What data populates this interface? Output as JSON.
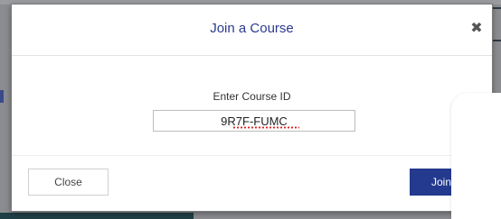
{
  "modal": {
    "title": "Join a Course",
    "close_icon": "close-icon",
    "field_label": "Enter Course ID",
    "course_id_value": "9R7F-FUMC",
    "course_id_placeholder": ""
  },
  "footer": {
    "close_label": "Close",
    "join_label": "Join"
  },
  "colors": {
    "accent": "#243a8f",
    "title": "#2b3a8f",
    "overlay": "#8a8c90"
  }
}
